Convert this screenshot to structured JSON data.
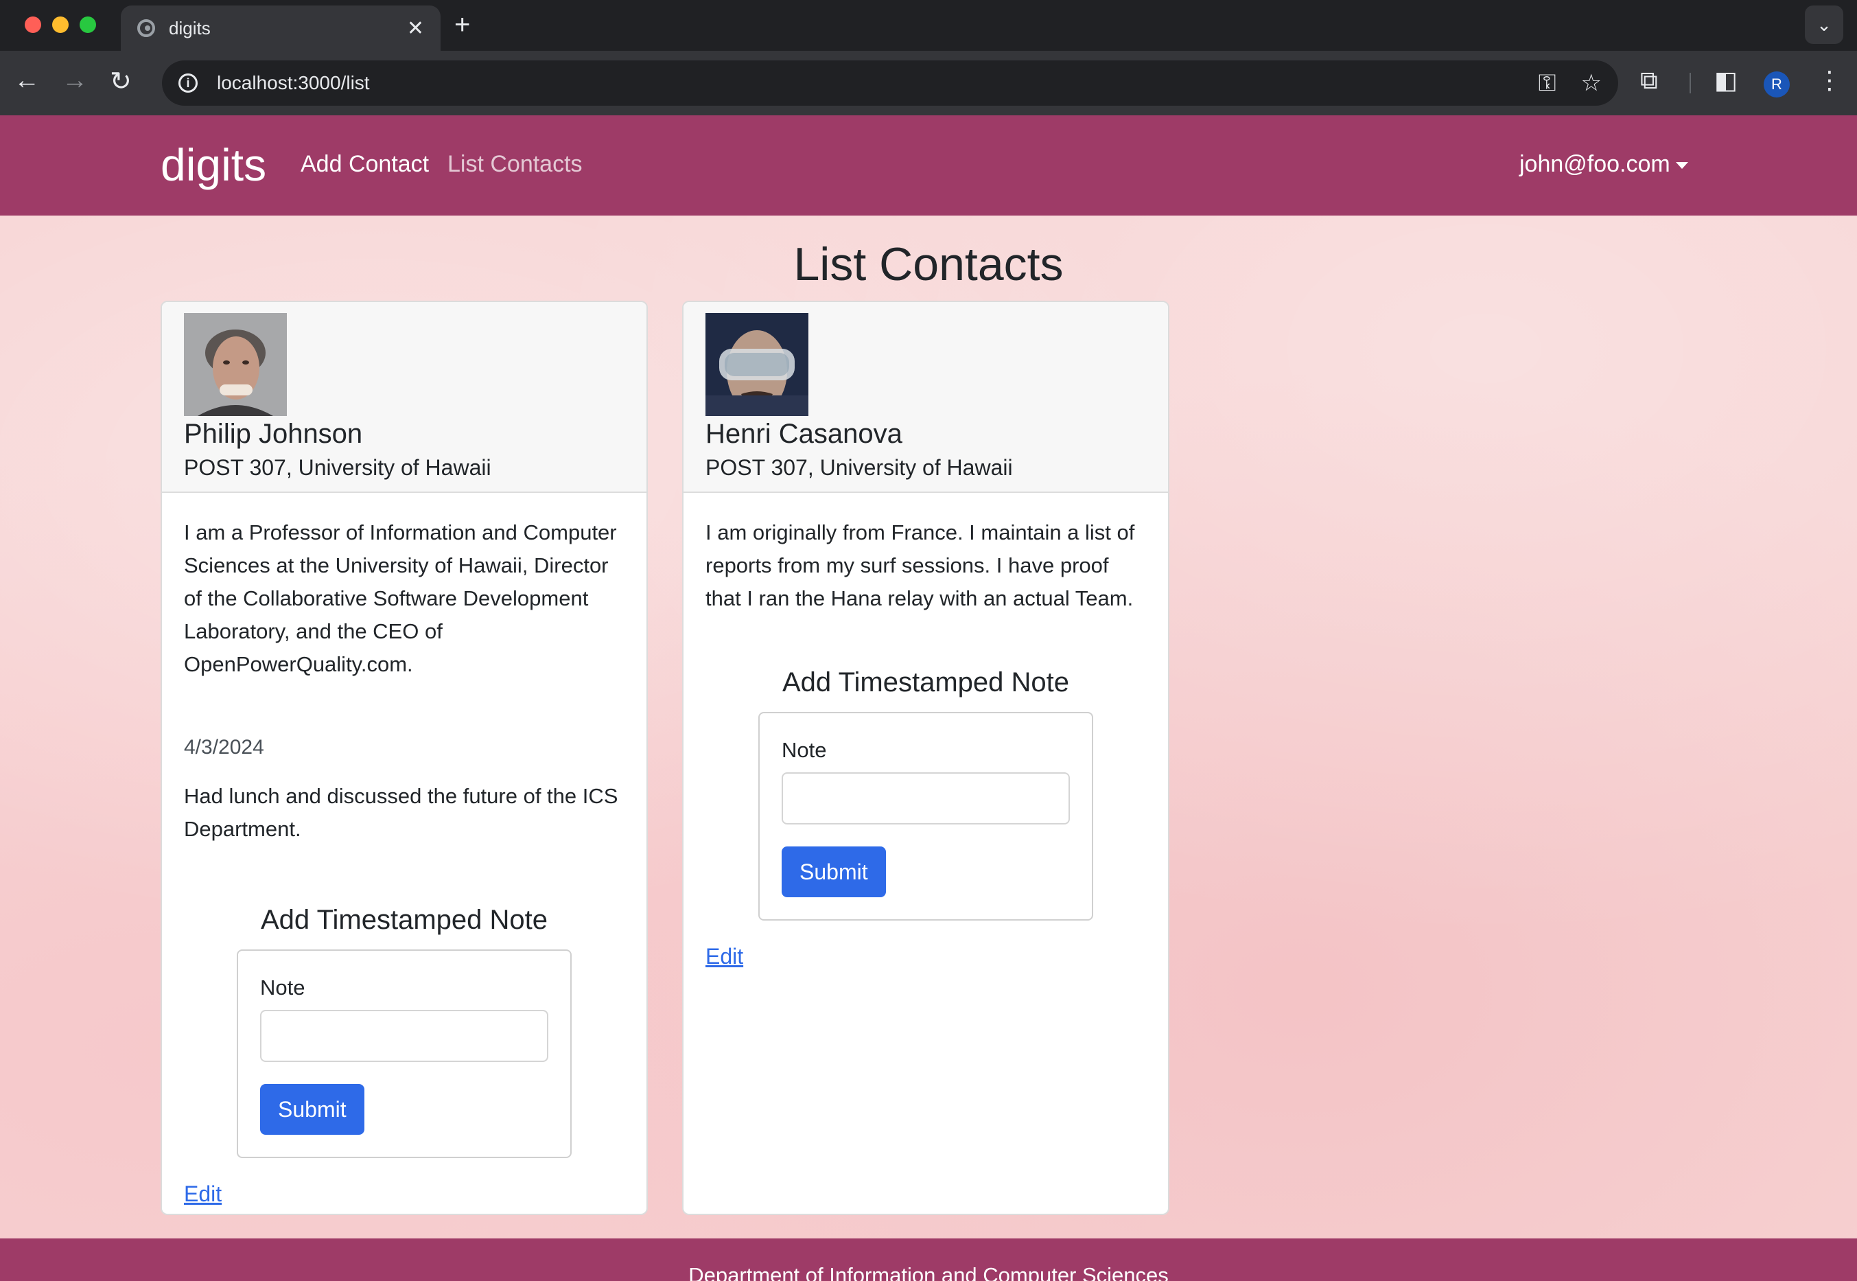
{
  "browser": {
    "tab_title": "digits",
    "url": "localhost:3000/list",
    "profile_initial": "R"
  },
  "navbar": {
    "brand": "digits",
    "links": [
      "Add Contact",
      "List Contacts"
    ],
    "user": "john@foo.com",
    "color": "#9e3b67"
  },
  "page": {
    "title": "List Contacts"
  },
  "contacts": [
    {
      "name": "Philip Johnson",
      "address": "POST 307, University of Hawaii",
      "description": "I am a Professor of Information and Computer Sciences at the University of Hawaii, Director of the Collaborative Software Development Laboratory, and the CEO of OpenPowerQuality.com.",
      "notes": [
        {
          "date": "4/3/2024",
          "text": "Had lunch and discussed the future of the ICS Department."
        }
      ],
      "add_note_title": "Add Timestamped Note",
      "note_label": "Note",
      "note_value": "",
      "submit_label": "Submit",
      "edit_label": "Edit"
    },
    {
      "name": "Henri Casanova",
      "address": "POST 307, University of Hawaii",
      "description": "I am originally from France. I maintain a list of reports from my surf sessions. I have proof that I ran the Hana relay with an actual Team.",
      "notes": [],
      "add_note_title": "Add Timestamped Note",
      "note_label": "Note",
      "note_value": "",
      "submit_label": "Submit",
      "edit_label": "Edit"
    }
  ],
  "footer": {
    "text": "Department of Information and Computer Sciences"
  },
  "colors": {
    "primary_button": "#2e6ae8",
    "background": "#f7d3d3"
  }
}
